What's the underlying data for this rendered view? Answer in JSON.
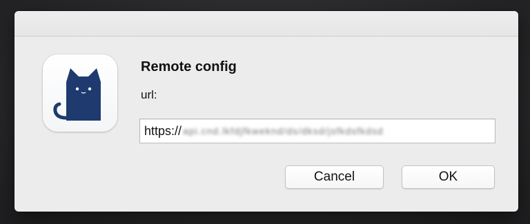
{
  "dialog": {
    "app_icon": "cat-app-icon",
    "title": "Remote config",
    "field_label": "url:",
    "url_input": {
      "visible_prefix": "https://",
      "obscured_text": "api.cnd.lkfdjfkweknd/ds/dksd/jsfkdsfkdsd"
    },
    "buttons": {
      "cancel_label": "Cancel",
      "ok_label": "OK"
    }
  },
  "colors": {
    "icon_cat": "#1e3a6e",
    "dialog_bg": "#ececec"
  }
}
